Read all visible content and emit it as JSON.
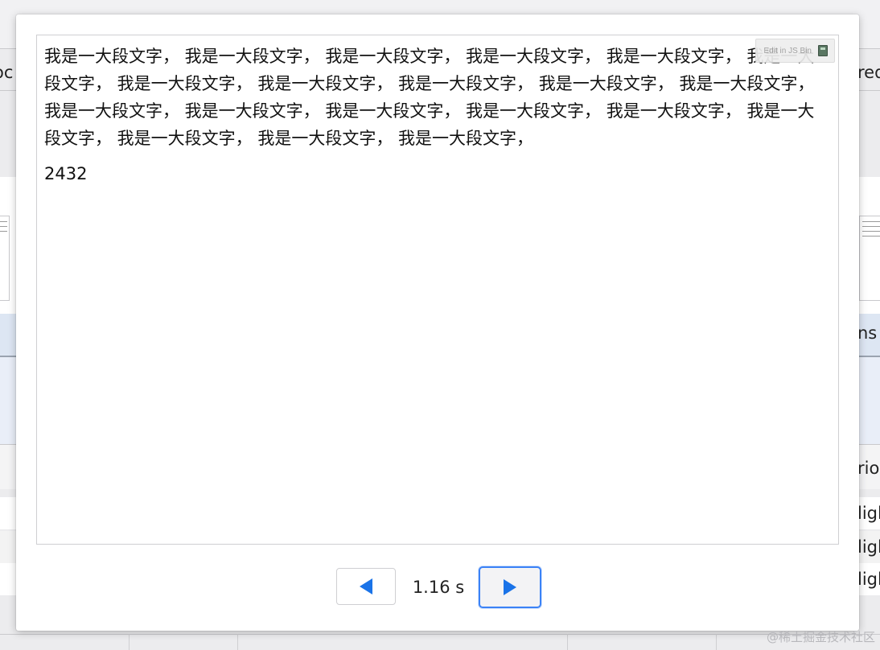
{
  "background": {
    "edge_left_row1": "oc",
    "edge_right_row1": "req",
    "edge_right_header": "ns",
    "edge_right_row2": "rio",
    "edge_right_row3": "ligl",
    "edge_right_row4": "ligl",
    "edge_right_row5": "ligl"
  },
  "dialog": {
    "frame": {
      "jsbin_badge_label": "Edit in JS Bin",
      "long_text": "我是一大段文字， 我是一大段文字， 我是一大段文字， 我是一大段文字， 我是一大段文字， 我是一大段文字， 我是一大段文字， 我是一大段文字， 我是一大段文字， 我是一大段文字， 我是一大段文字， 我是一大段文字， 我是一大段文字， 我是一大段文字， 我是一大段文字， 我是一大段文字， 我是一大段文字， 我是一大段文字， 我是一大段文字， 我是一大段文字，",
      "counter": "2432"
    },
    "controls": {
      "time_label": "1.16 s"
    }
  },
  "watermark": "@稀土掘金技术社区",
  "icons": {
    "prev": "play-left-icon",
    "next": "play-right-icon",
    "jsbin": "jsbin-logo-icon"
  },
  "colors": {
    "accent": "#1a73e8",
    "focus_ring": "#3b82f6"
  }
}
